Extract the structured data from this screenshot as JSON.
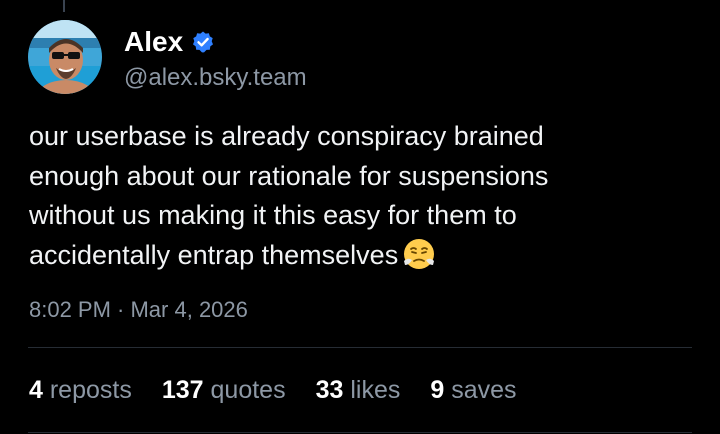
{
  "author": {
    "display_name": "Alex",
    "handle": "@alex.bsky.team",
    "verified": true,
    "verified_color": "#2f80ff"
  },
  "post": {
    "lines": [
      "our userbase is already conspiracy brained",
      "enough about our rationale for suspensions",
      "without us making it this easy for them to",
      "accidentally entrap themselves"
    ],
    "emoji": "face-with-steam-from-nose",
    "timestamp": "8:02 PM · Mar 4, 2026"
  },
  "stats": {
    "reposts": {
      "count": "4",
      "label": "reposts"
    },
    "quotes": {
      "count": "137",
      "label": "quotes"
    },
    "likes": {
      "count": "33",
      "label": "likes"
    },
    "saves": {
      "count": "9",
      "label": "saves"
    }
  },
  "colors": {
    "background": "#000000",
    "text": "#f1f3f5",
    "muted": "#8d98a5",
    "divider": "#262c34"
  }
}
